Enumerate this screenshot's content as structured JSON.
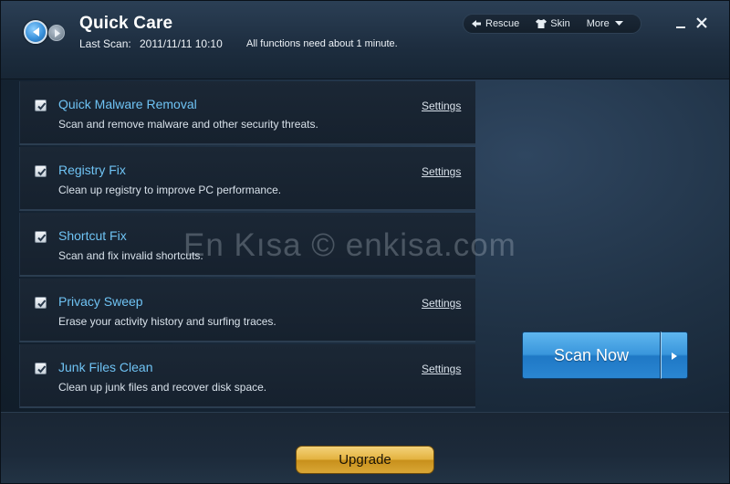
{
  "header": {
    "title": "Quick Care",
    "last_scan_label": "Last Scan:",
    "last_scan_date": "2011/11/11 10:10",
    "note": "All functions need about 1 minute."
  },
  "toolbar": {
    "rescue_label": "Rescue",
    "skin_label": "Skin",
    "more_label": "More"
  },
  "tasks": [
    {
      "name": "Quick Malware Removal",
      "description": "Scan and remove malware and other security threats.",
      "settings": "Settings",
      "checked": true
    },
    {
      "name": "Registry Fix",
      "description": "Clean up registry to improve PC performance.",
      "settings": "Settings",
      "checked": true
    },
    {
      "name": "Shortcut Fix",
      "description": "Scan and fix invalid shortcuts.",
      "settings": "",
      "checked": true
    },
    {
      "name": "Privacy Sweep",
      "description": "Erase your activity history and surfing traces.",
      "settings": "Settings",
      "checked": true
    },
    {
      "name": "Junk Files Clean",
      "description": "Clean up junk files and recover disk space.",
      "settings": "Settings",
      "checked": true
    }
  ],
  "watermark": "En Kısa © enkisa.com",
  "actions": {
    "scan_now_label": "Scan Now",
    "upgrade_label": "Upgrade"
  },
  "icons": {
    "back": "back-arrow-icon",
    "forward": "forward-arrow-icon",
    "rescue": "rescue-arrow-icon",
    "skin": "shirt-icon",
    "more": "chevron-down-icon",
    "minimize": "minimize-icon",
    "close": "close-icon",
    "check": "checkbox-checked-icon",
    "scan_menu": "triangle-right-icon"
  },
  "colors": {
    "accent_blue": "#3996dc",
    "task_title": "#6fc3f4",
    "upgrade_gold": "#e4b340"
  }
}
